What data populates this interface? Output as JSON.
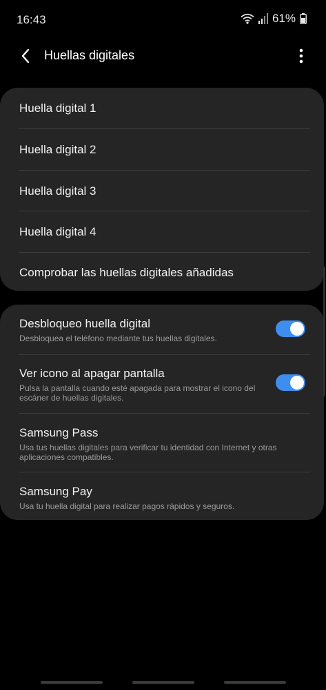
{
  "status_bar": {
    "time": "16:43",
    "battery_percent": "61%",
    "icons": [
      "wifi-icon",
      "signal-icon",
      "battery-icon"
    ]
  },
  "header": {
    "title": "Huellas digitales",
    "back_icon": "chevron-left-icon",
    "more_icon": "more-vertical-icon"
  },
  "fingerprints": {
    "items": [
      {
        "label": "Huella digital 1"
      },
      {
        "label": "Huella digital 2"
      },
      {
        "label": "Huella digital 3"
      },
      {
        "label": "Huella digital 4"
      }
    ],
    "check_label": "Comprobar las huellas digitales añadidas"
  },
  "settings": {
    "items": [
      {
        "title": "Desbloqueo huella digital",
        "description": "Desbloquea el teléfono mediante tus huellas digitales.",
        "toggle_on": true
      },
      {
        "title": "Ver icono al apagar pantalla",
        "description": "Pulsa la pantalla cuando esté apagada para mostrar el icono del escáner de huellas digitales.",
        "toggle_on": true
      },
      {
        "title": "Samsung Pass",
        "description": "Usa tus huellas digitales para verificar tu identidad con Internet y otras aplicaciones compatibles."
      },
      {
        "title": "Samsung Pay",
        "description": "Usa tu huella digital para realizar pagos rápidos y seguros."
      }
    ]
  },
  "colors": {
    "background": "#000000",
    "card": "#252525",
    "accent_toggle": "#3e8ef0",
    "secondary_text": "#9a9a9a"
  }
}
